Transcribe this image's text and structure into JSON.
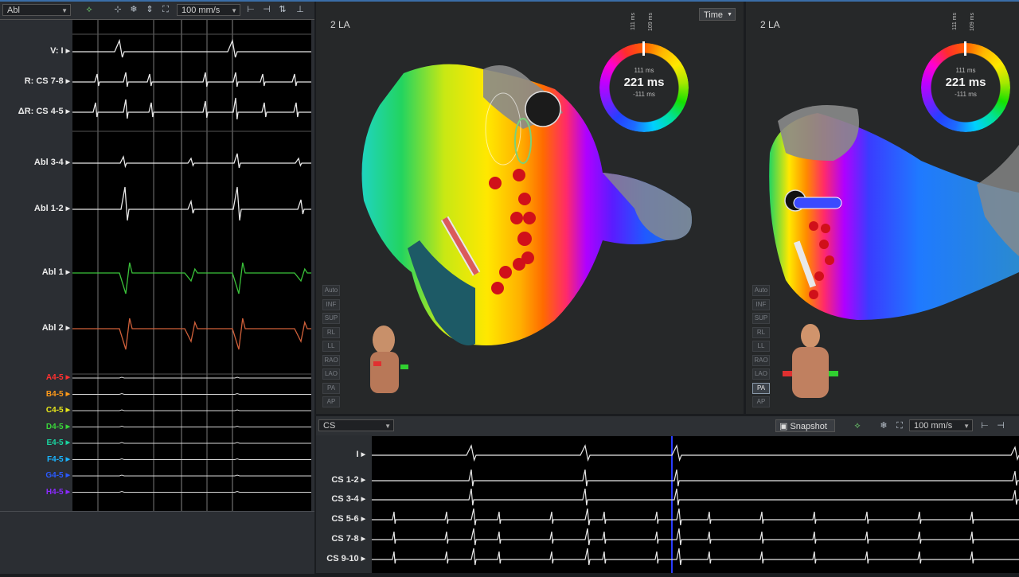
{
  "left_toolbar": {
    "channel_select": "Abl",
    "sweep_speed": "100 mm/s"
  },
  "left_traces": [
    {
      "label": "V: I",
      "color": "#e8e8e8"
    },
    {
      "label": "R: CS 7-8",
      "color": "#e8e8e8"
    },
    {
      "label": "ΔR: CS 4-5",
      "color": "#e8e8e8"
    },
    {
      "label": "Abl 3-4",
      "color": "#e8e8e8"
    },
    {
      "label": "Abl 1-2",
      "color": "#e8e8e8"
    },
    {
      "label": "Abl 1",
      "color": "#3ac23a"
    },
    {
      "label": "Abl 2",
      "color": "#d0603a"
    }
  ],
  "mini_traces": [
    {
      "label": "A4-5",
      "color": "#ff3030"
    },
    {
      "label": "B4-5",
      "color": "#ff9a1a"
    },
    {
      "label": "C4-5",
      "color": "#e8e81a"
    },
    {
      "label": "D4-5",
      "color": "#3ad43a"
    },
    {
      "label": "E4-5",
      "color": "#1ad4a0"
    },
    {
      "label": "F4-5",
      "color": "#1ab4ff"
    },
    {
      "label": "G4-5",
      "color": "#2a5aff"
    },
    {
      "label": "H4-5",
      "color": "#8a2aff"
    }
  ],
  "map1": {
    "title": "2 LA",
    "time_select": "Time",
    "ring": {
      "top_low": "111 ms",
      "top_high": "109 ms",
      "upper_small": "111 ms",
      "center": "221 ms",
      "lower_small": "-111 ms"
    },
    "view_buttons": [
      "Auto",
      "INF",
      "SUP",
      "RL",
      "LL",
      "RAO",
      "LAO",
      "PA",
      "AP"
    ],
    "active_view": ""
  },
  "map2": {
    "title": "2 LA",
    "ring": {
      "top_low": "111 ms",
      "top_high": "109 ms",
      "upper_small": "111 ms",
      "center": "221 ms",
      "lower_small": "-111 ms"
    },
    "view_buttons": [
      "Auto",
      "INF",
      "SUP",
      "RL",
      "LL",
      "RAO",
      "LAO",
      "PA",
      "AP"
    ],
    "active_view": "PA"
  },
  "cs_panel": {
    "channel_select": "CS",
    "snapshot_label": "Snapshot",
    "sweep_speed": "100 mm/s",
    "traces": [
      "I",
      "CS 1-2",
      "CS 3-4",
      "CS 5-6",
      "CS 7-8",
      "CS 9-10"
    ]
  },
  "colors": {
    "accent": "#3a6ea8",
    "marker": "#2a3cff"
  }
}
